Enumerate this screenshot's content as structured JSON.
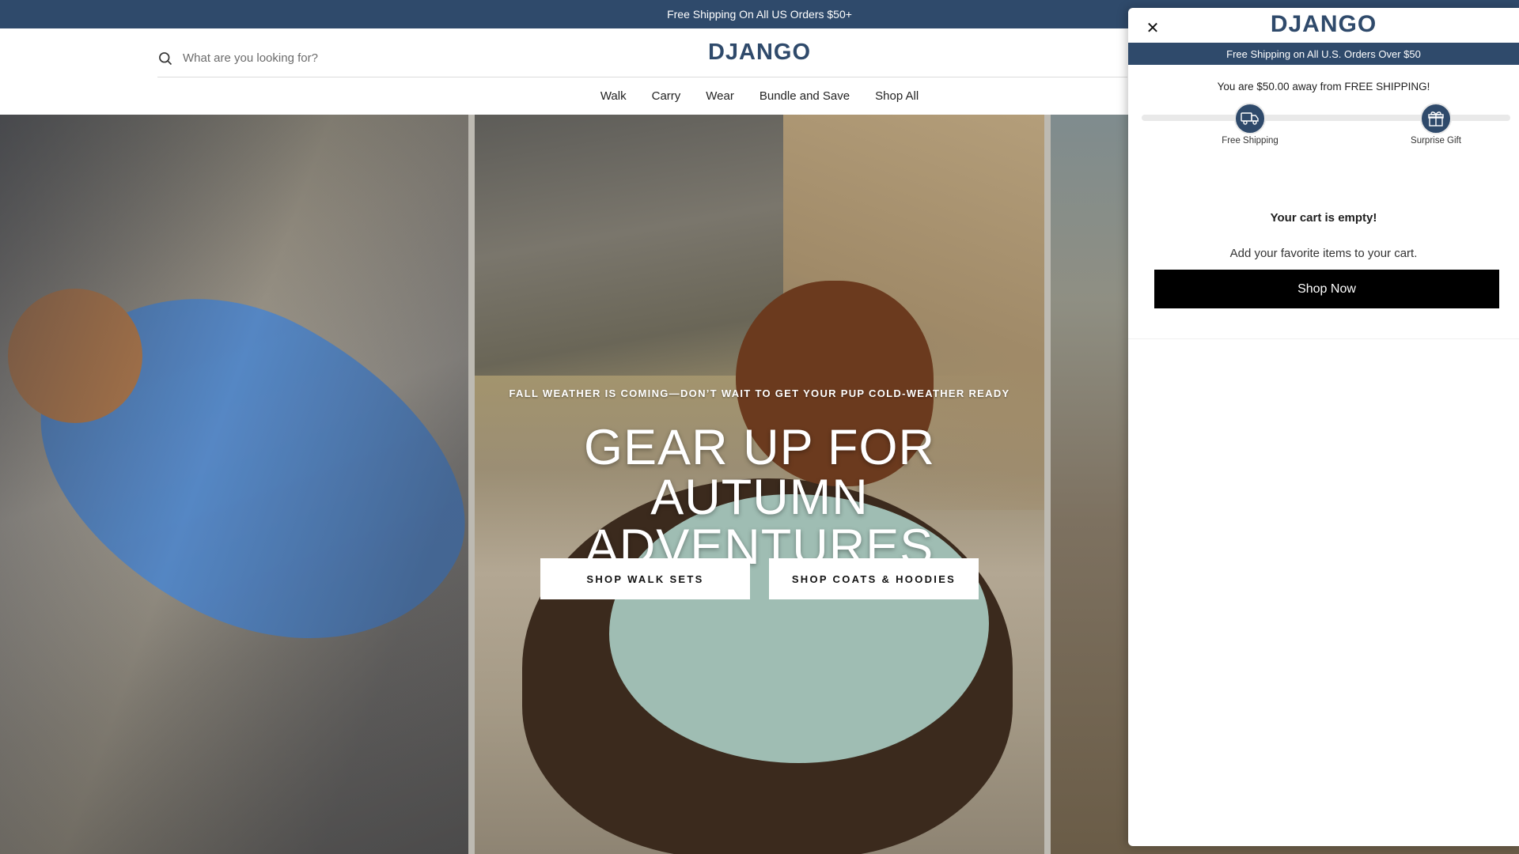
{
  "announcement": {
    "text": "Free Shipping On All US Orders $50+"
  },
  "header": {
    "logo": "DJANGO",
    "search": {
      "placeholder": "What are you looking for?"
    },
    "nav": [
      "Walk",
      "Carry",
      "Wear",
      "Bundle and Save",
      "Shop All"
    ]
  },
  "hero": {
    "kicker": "FALL WEATHER IS COMING—DON’T WAIT TO GET YOUR PUP COLD-WEATHER READY",
    "headline_line1": "GEAR UP FOR AUTUMN",
    "headline_line2": "ADVENTURES",
    "cta_primary": "SHOP WALK SETS",
    "cta_secondary": "SHOP COATS & HOODIES"
  },
  "cart_drawer": {
    "logo": "DJANGO",
    "banner": "Free Shipping on All U.S. Orders Over $50",
    "progress_message": "You are $50.00 away from FREE SHIPPING!",
    "progress_fraction": 0,
    "milestones": [
      {
        "label": "Free Shipping",
        "icon": "truck-icon"
      },
      {
        "label": "Surprise Gift",
        "icon": "gift-icon"
      }
    ],
    "empty_title": "Your cart is empty!",
    "empty_subtitle": "Add your favorite items to your cart.",
    "shop_now_label": "Shop Now"
  },
  "colors": {
    "brand_navy": "#2f4a6b",
    "button_black": "#000000"
  }
}
